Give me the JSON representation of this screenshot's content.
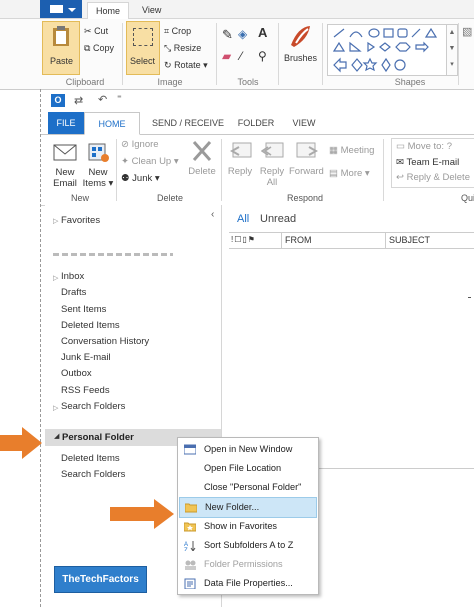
{
  "paint": {
    "tabs": [
      "Home",
      "View"
    ],
    "clipboard": {
      "paste": "Paste",
      "cut": "Cut",
      "copy": "Copy",
      "label": "Clipboard"
    },
    "image": {
      "select": "Select",
      "crop": "Crop",
      "resize": "Resize",
      "rotate": "Rotate",
      "label": "Image"
    },
    "tools": {
      "label": "Tools"
    },
    "brushes": "Brushes",
    "shapes": {
      "label": "Shapes"
    }
  },
  "outlook": {
    "tabs": [
      "FILE",
      "HOME",
      "SEND / RECEIVE",
      "FOLDER",
      "VIEW"
    ],
    "ribbon": {
      "new_email": [
        "New",
        "Email"
      ],
      "new_items": [
        "New",
        "Items"
      ],
      "group_new": "New",
      "ignore": "Ignore",
      "clean_up": "Clean Up",
      "junk": "Junk",
      "delete": "Delete",
      "group_delete": "Delete",
      "reply": "Reply",
      "reply_all": [
        "Reply",
        "All"
      ],
      "forward": "Forward",
      "meeting": "Meeting",
      "more": "More",
      "group_respond": "Respond",
      "move_to": "Move to: ?",
      "team_email": "Team E-mail",
      "reply_delete": "Reply & Delete",
      "group_qs": "Qui"
    },
    "nav": {
      "favorites": "Favorites",
      "folders": [
        "Inbox",
        "Drafts",
        "Sent Items",
        "Deleted Items",
        "Conversation History",
        "Junk E-mail",
        "Outbox",
        "RSS Feeds",
        "Search Folders"
      ],
      "personal_folder": "Personal Folder",
      "personal_items": [
        "Deleted Items",
        "Search Folders"
      ]
    },
    "list": {
      "filter_all": "All",
      "filter_unread": "Unread",
      "col_from": "FROM",
      "col_subject": "SUBJECT"
    },
    "context_menu": [
      {
        "label": "Open in New Window",
        "enabled": true
      },
      {
        "label": "Open File Location",
        "enabled": true
      },
      {
        "label": "Close \"Personal Folder\"",
        "enabled": true
      },
      {
        "label": "New Folder...",
        "enabled": true,
        "highlighted": true
      },
      {
        "label": "Show in Favorites",
        "enabled": true
      },
      {
        "label": "Sort Subfolders A to Z",
        "enabled": true
      },
      {
        "label": "Folder Permissions",
        "enabled": false
      },
      {
        "label": "Data File Properties...",
        "enabled": true
      }
    ],
    "logo": "TheTechFactors"
  },
  "colors": {
    "accent": "#1d6fc8",
    "arrow": "#e87e2c",
    "highlight": "#cde6f7"
  }
}
